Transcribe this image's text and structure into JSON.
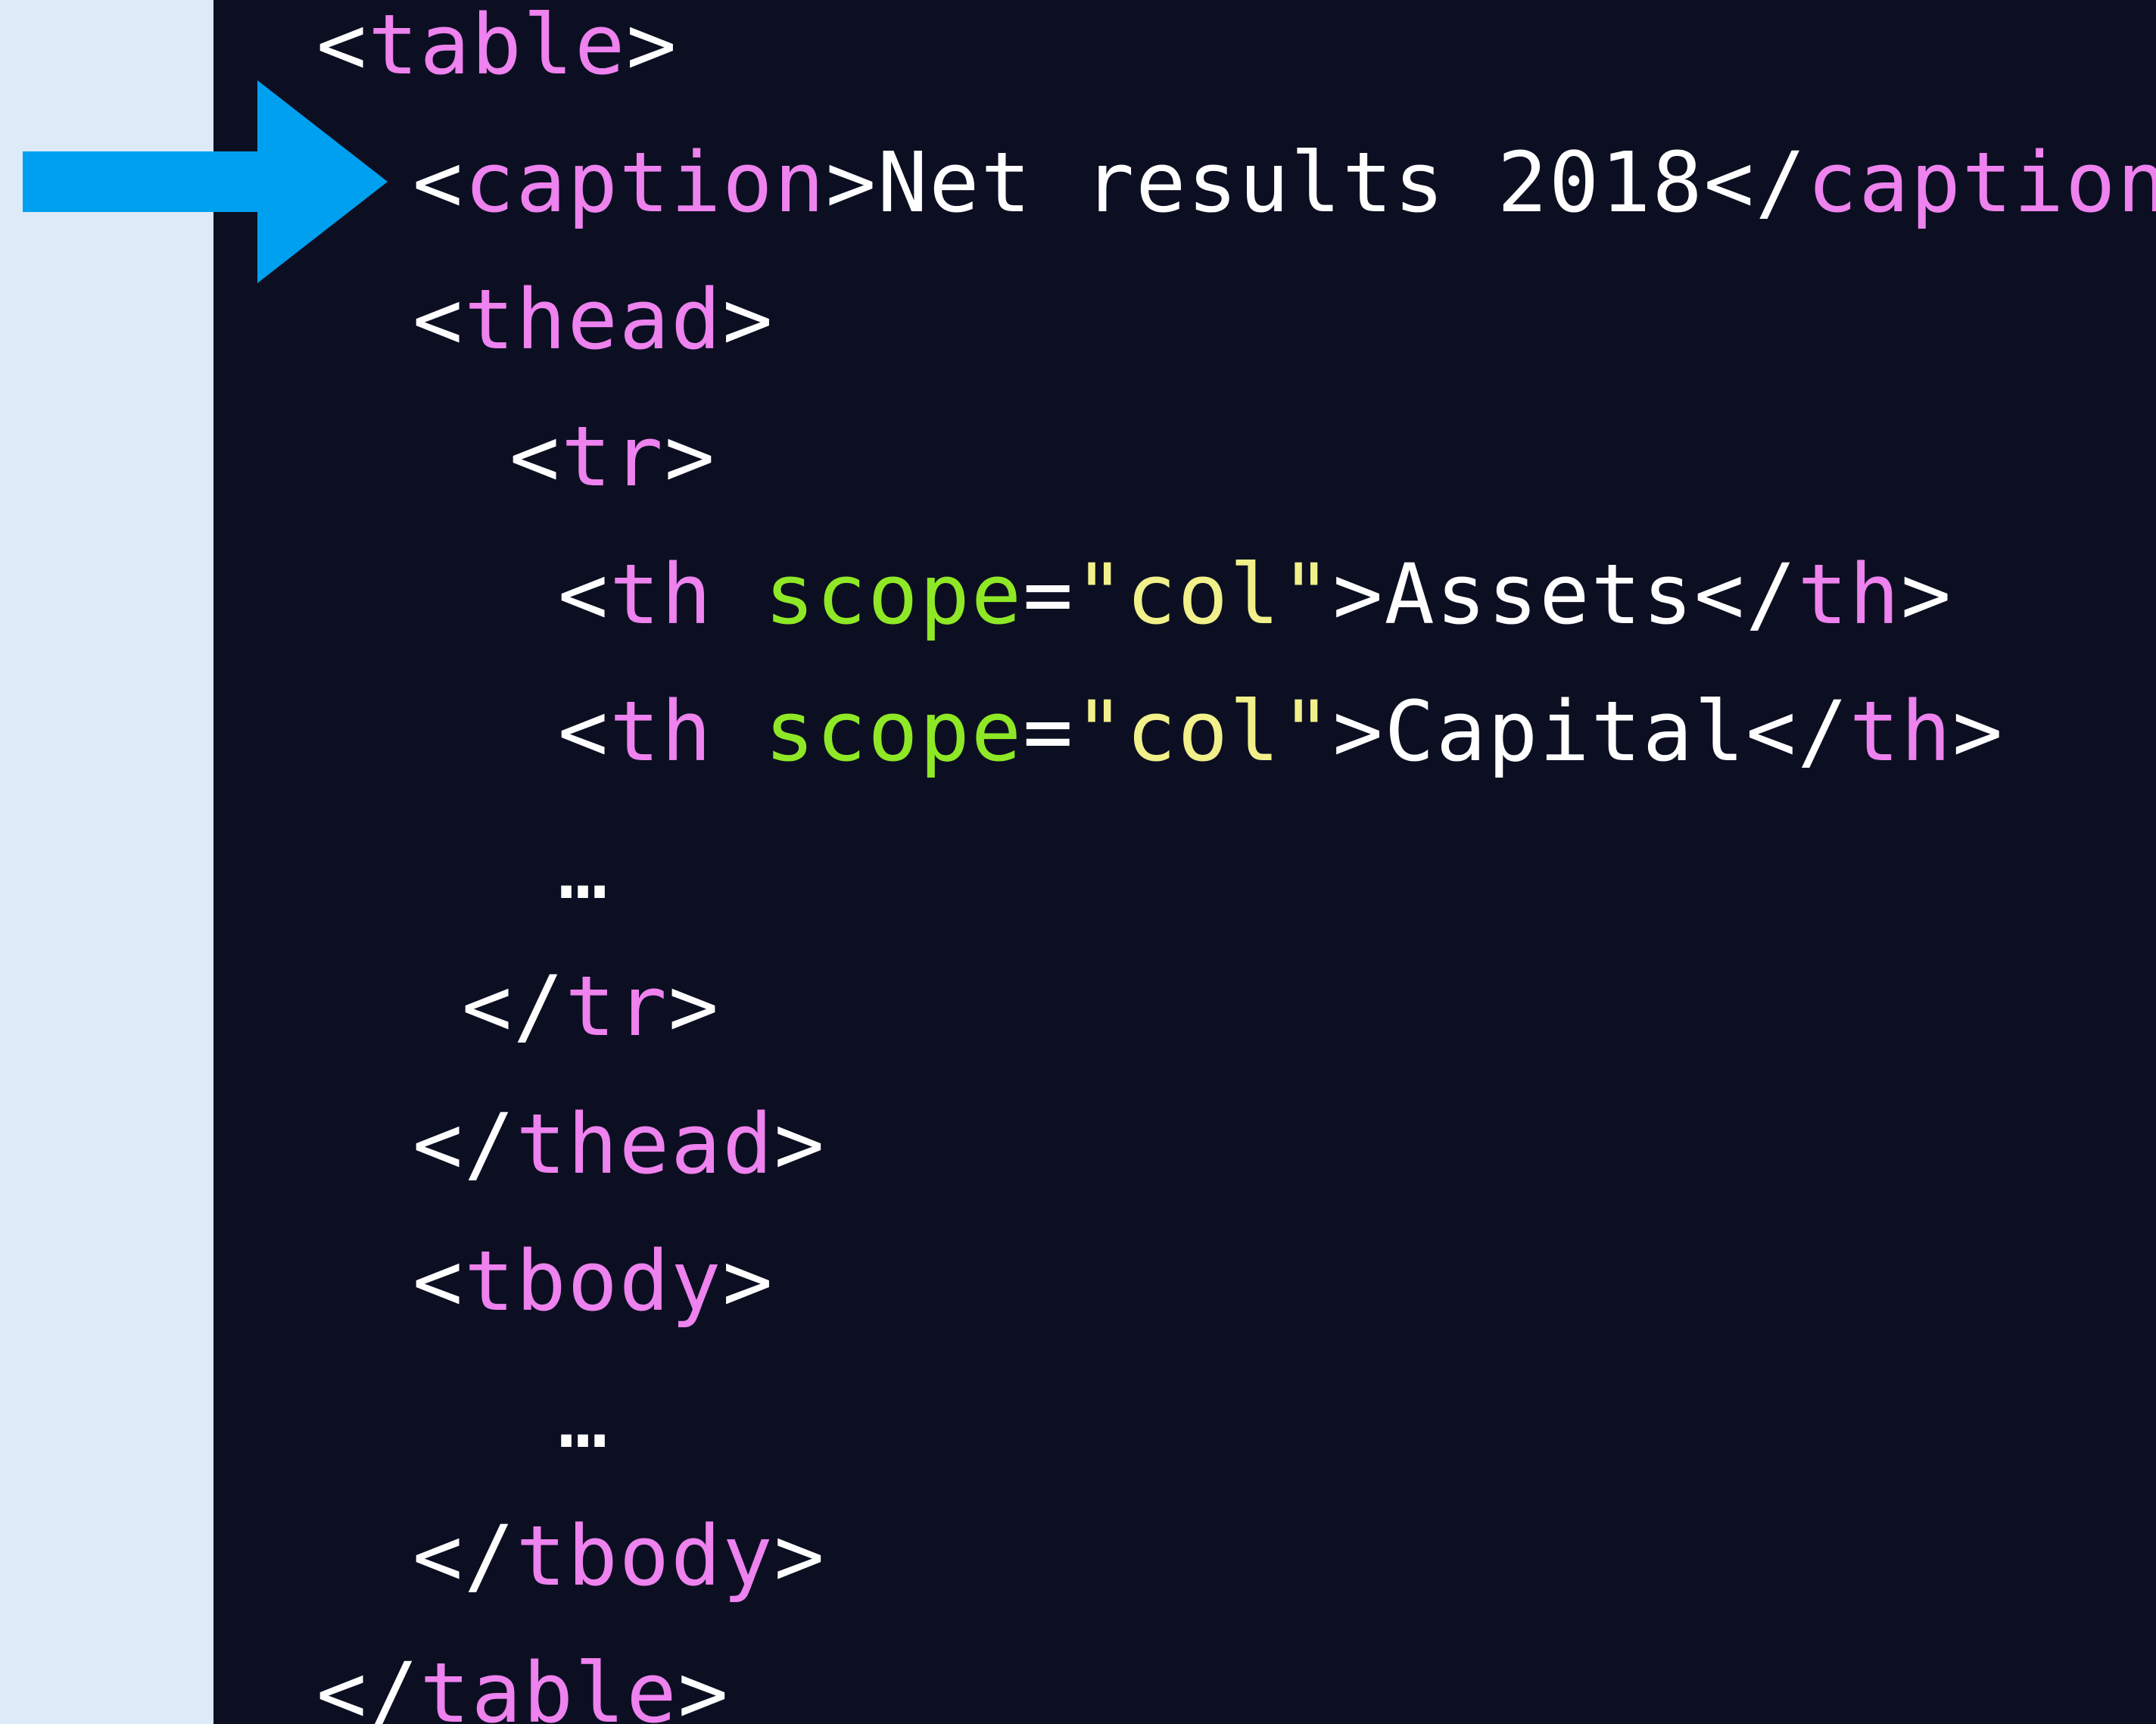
{
  "colors": {
    "background": "#ddeaf7",
    "code_background": "#0c0f22",
    "punctuation": "#ffffff",
    "tag_name": "#ee82ee",
    "attribute_name": "#8fe826",
    "attribute_value": "#f1f08a",
    "text": "#ffffff",
    "arrow": "#00a0f0"
  },
  "arrow": {
    "icon": "arrow-right-icon",
    "points_to_line": 2
  },
  "code": {
    "lines": [
      {
        "tokens": [
          {
            "t": "punct",
            "v": "<"
          },
          {
            "t": "tag",
            "v": "table"
          },
          {
            "t": "punct",
            "v": ">"
          }
        ]
      },
      {
        "tokens": [
          {
            "t": "punct",
            "v": "<"
          },
          {
            "t": "tag",
            "v": "caption"
          },
          {
            "t": "punct",
            "v": ">"
          },
          {
            "t": "text",
            "v": "Net results 2018"
          },
          {
            "t": "punct",
            "v": "</"
          },
          {
            "t": "tag",
            "v": "caption"
          },
          {
            "t": "punct",
            "v": ">"
          }
        ]
      },
      {
        "tokens": [
          {
            "t": "punct",
            "v": "<"
          },
          {
            "t": "tag",
            "v": "thead"
          },
          {
            "t": "punct",
            "v": ">"
          }
        ]
      },
      {
        "tokens": [
          {
            "t": "punct",
            "v": "<"
          },
          {
            "t": "tag",
            "v": "tr"
          },
          {
            "t": "punct",
            "v": ">"
          }
        ]
      },
      {
        "tokens": [
          {
            "t": "punct",
            "v": "<"
          },
          {
            "t": "tag",
            "v": "th"
          },
          {
            "t": "punct",
            "v": " "
          },
          {
            "t": "attr",
            "v": "scope"
          },
          {
            "t": "punct",
            "v": "="
          },
          {
            "t": "str",
            "v": "\"col\""
          },
          {
            "t": "punct",
            "v": ">"
          },
          {
            "t": "text",
            "v": "Assets"
          },
          {
            "t": "punct",
            "v": "</"
          },
          {
            "t": "tag",
            "v": "th"
          },
          {
            "t": "punct",
            "v": ">"
          }
        ]
      },
      {
        "tokens": [
          {
            "t": "punct",
            "v": "<"
          },
          {
            "t": "tag",
            "v": "th"
          },
          {
            "t": "punct",
            "v": " "
          },
          {
            "t": "attr",
            "v": "scope"
          },
          {
            "t": "punct",
            "v": "="
          },
          {
            "t": "str",
            "v": "\"col\""
          },
          {
            "t": "punct",
            "v": ">"
          },
          {
            "t": "text",
            "v": "Capital"
          },
          {
            "t": "punct",
            "v": "</"
          },
          {
            "t": "tag",
            "v": "th"
          },
          {
            "t": "punct",
            "v": ">"
          }
        ]
      },
      {
        "tokens": [
          {
            "t": "text",
            "v": "…"
          }
        ]
      },
      {
        "tokens": [
          {
            "t": "punct",
            "v": "</"
          },
          {
            "t": "tag",
            "v": "tr"
          },
          {
            "t": "punct",
            "v": ">"
          }
        ]
      },
      {
        "tokens": [
          {
            "t": "punct",
            "v": "</"
          },
          {
            "t": "tag",
            "v": "thead"
          },
          {
            "t": "punct",
            "v": ">"
          }
        ]
      },
      {
        "tokens": [
          {
            "t": "punct",
            "v": "<"
          },
          {
            "t": "tag",
            "v": "tbody"
          },
          {
            "t": "punct",
            "v": ">"
          }
        ]
      },
      {
        "tokens": [
          {
            "t": "text",
            "v": "…"
          }
        ]
      },
      {
        "tokens": [
          {
            "t": "punct",
            "v": "</"
          },
          {
            "t": "tag",
            "v": "tbody"
          },
          {
            "t": "punct",
            "v": ">"
          }
        ]
      },
      {
        "tokens": [
          {
            "t": "punct",
            "v": "</"
          },
          {
            "t": "tag",
            "v": "table"
          },
          {
            "t": "punct",
            "v": ">"
          }
        ]
      }
    ]
  }
}
